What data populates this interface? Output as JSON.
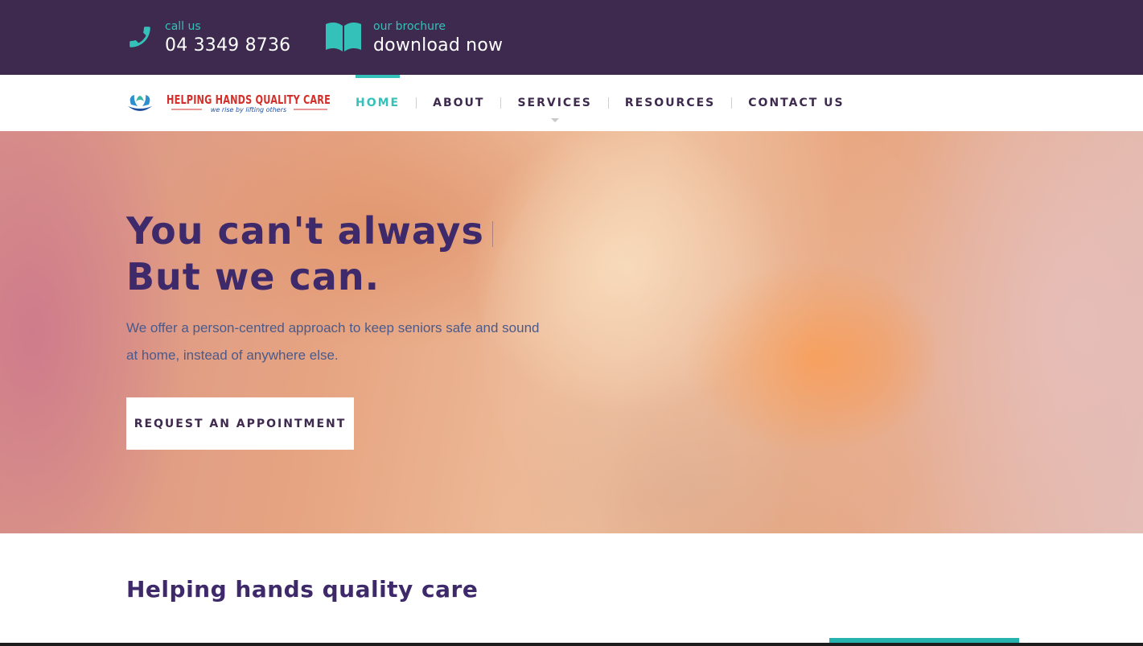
{
  "topbar": {
    "phone": {
      "icon": "phone-icon",
      "label": "call us",
      "value": "04 3349 8736"
    },
    "brochure": {
      "icon": "book-icon",
      "label": "our brochure",
      "value": "download now"
    }
  },
  "logo": {
    "name": "HELPING HANDS QUALITY CARE",
    "tagline": "we rise by lifting others"
  },
  "nav": {
    "items": [
      {
        "label": "HOME",
        "active": true
      },
      {
        "label": "ABOUT",
        "active": false
      },
      {
        "label": "SERVICES",
        "active": false,
        "has_dropdown": true
      },
      {
        "label": "RESOURCES",
        "active": false
      },
      {
        "label": "CONTACT US",
        "active": false
      }
    ]
  },
  "hero": {
    "title_line1": "You can't always",
    "title_line2": "But we can.",
    "text": "We offer a person-centred approach to keep seniors safe and sound at home, instead of anywhere else.",
    "button": "REQUEST AN APPOINTMENT"
  },
  "section": {
    "title": "Helping hands quality care"
  },
  "colors": {
    "topbar_bg": "#3e2a4e",
    "accent": "#33c1ba",
    "heading": "#3e2a6b"
  }
}
